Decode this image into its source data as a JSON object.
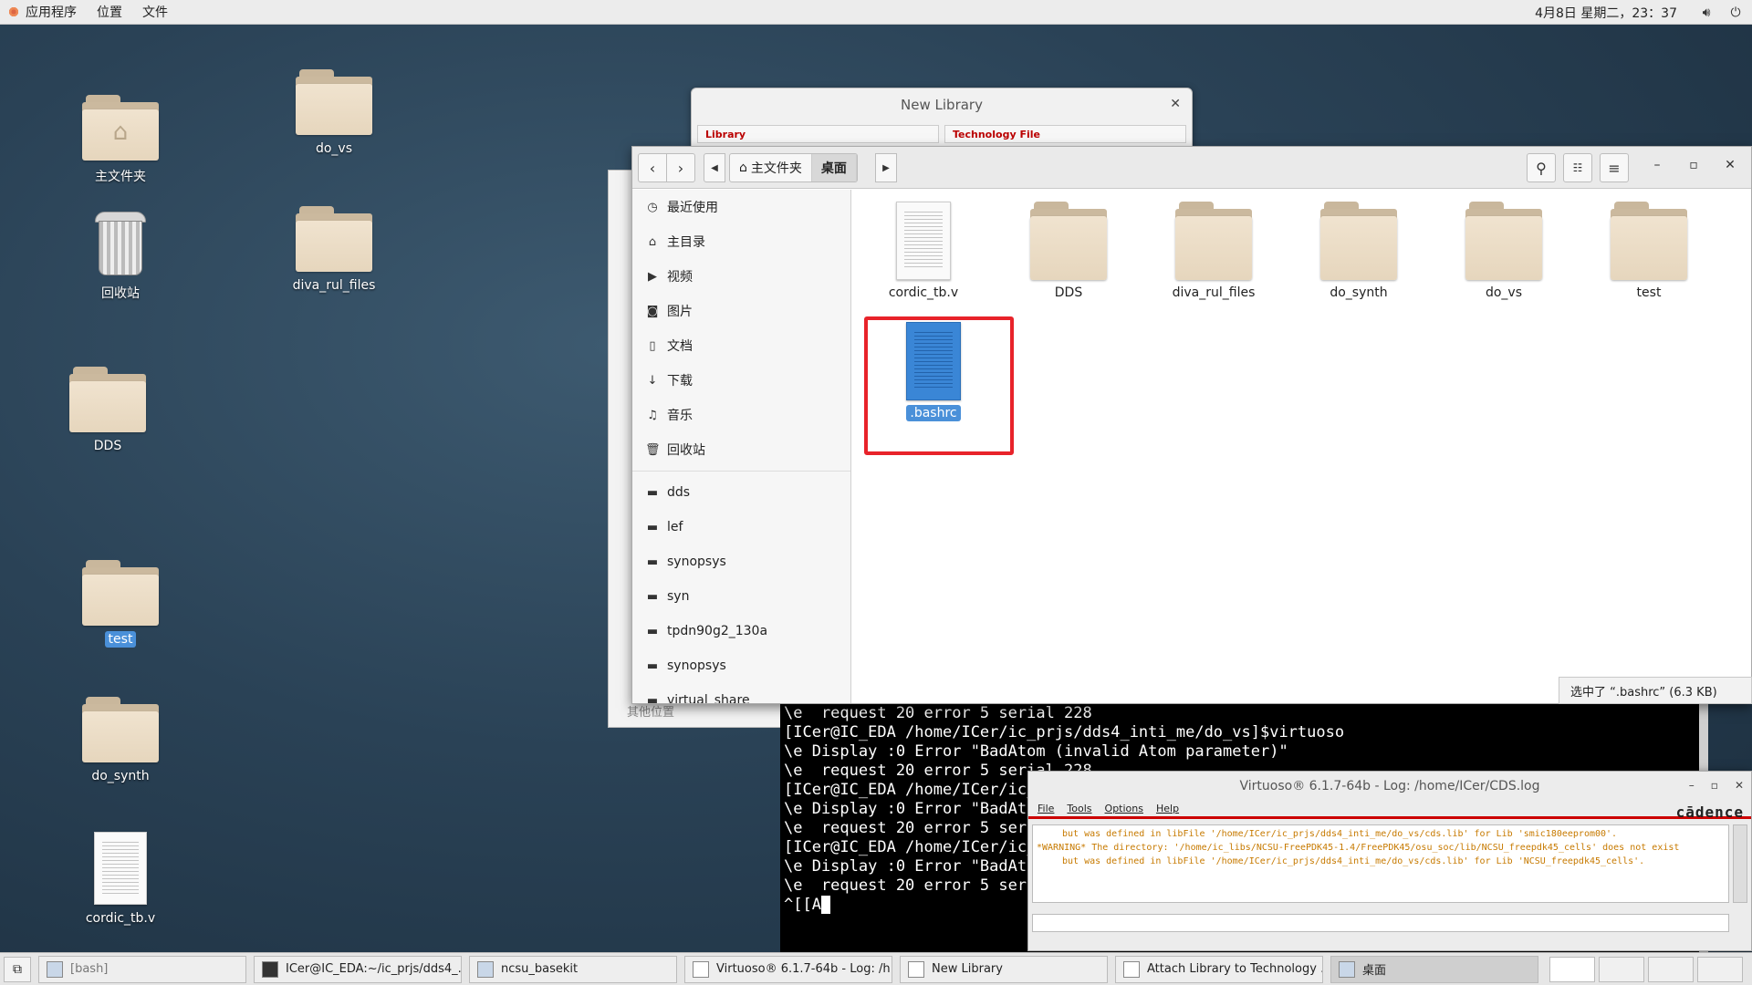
{
  "topbar": {
    "menu": [
      "应用程序",
      "位置",
      "文件"
    ],
    "clock": "4月8日 星期二，23：37",
    "icons": [
      "volume-icon",
      "power-icon"
    ]
  },
  "desktop": {
    "icons": [
      {
        "label": "主文件夹",
        "kind": "home-folder"
      },
      {
        "label": "回收站",
        "kind": "trash"
      },
      {
        "label": "DDS",
        "kind": "folder"
      },
      {
        "label": "test",
        "kind": "folder",
        "selected": true
      },
      {
        "label": "do_synth",
        "kind": "folder"
      },
      {
        "label": "cordic_tb.v",
        "kind": "document"
      },
      {
        "label": "do_vs",
        "kind": "folder"
      },
      {
        "label": "diva_rul_files",
        "kind": "folder"
      }
    ]
  },
  "new_library": {
    "title": "New Library",
    "tabs": [
      "Library",
      "Technology File"
    ]
  },
  "back_window": {
    "other_locations": "其他位置"
  },
  "file_manager": {
    "breadcrumb": [
      "主文件夹",
      "桌面"
    ],
    "sidebar": [
      {
        "label": "最近使用",
        "icon": "clock-icon"
      },
      {
        "label": "主目录",
        "icon": "home-icon"
      },
      {
        "label": "视频",
        "icon": "video-icon"
      },
      {
        "label": "图片",
        "icon": "camera-icon"
      },
      {
        "label": "文档",
        "icon": "document-icon"
      },
      {
        "label": "下载",
        "icon": "download-icon"
      },
      {
        "label": "音乐",
        "icon": "music-icon"
      },
      {
        "label": "回收站",
        "icon": "trash-icon"
      },
      {
        "label": "dds",
        "icon": "folder-icon"
      },
      {
        "label": "lef",
        "icon": "folder-icon"
      },
      {
        "label": "synopsys",
        "icon": "folder-icon"
      },
      {
        "label": "syn",
        "icon": "folder-icon"
      },
      {
        "label": "tpdn90g2_130a",
        "icon": "folder-icon"
      },
      {
        "label": "synopsys",
        "icon": "folder-icon"
      },
      {
        "label": "virtual_share",
        "icon": "folder-icon"
      }
    ],
    "files": [
      {
        "name": "cordic_tb.v",
        "kind": "document"
      },
      {
        "name": "DDS",
        "kind": "folder"
      },
      {
        "name": "diva_rul_files",
        "kind": "folder"
      },
      {
        "name": "do_synth",
        "kind": "folder"
      },
      {
        "name": "do_vs",
        "kind": "folder"
      },
      {
        "name": "test",
        "kind": "folder"
      },
      {
        "name": ".bashrc",
        "kind": "document",
        "selected": true
      }
    ],
    "status": "选中了 “.bashrc” (6.3 KB)"
  },
  "terminal": {
    "lines": [
      "\\e  request 20 error 5 serial 228",
      "[ICer@IC_EDA /home/ICer/ic_prjs/dds4_inti_me/do_vs]$virtuoso",
      "\\e Display :0 Error \"BadAtom (invalid Atom parameter)\"",
      "\\e  request 20 error 5 serial 228",
      "[ICer@IC_EDA /home/ICer/ic_",
      "\\e Display :0 Error \"BadAto",
      "\\e  request 20 error 5 seri",
      "[ICer@IC_EDA /home/ICer/ic_",
      "\\e Display :0 Error \"BadAto",
      "\\e  request 20 error 5 seri",
      "^[[A"
    ]
  },
  "virtuoso": {
    "title": "Virtuoso® 6.1.7-64b - Log: /home/ICer/CDS.log",
    "menu": [
      "File",
      "Tools",
      "Options",
      "Help"
    ],
    "brand": "cādence",
    "log": [
      "but was defined in libFile '/home/ICer/ic_prjs/dds4_inti_me/do_vs/cds.lib' for Lib 'smic180eeprom00'.",
      "*WARNING* The directory: '/home/ic_libs/NCSU-FreePDK45-1.4/FreePDK45/osu_soc/lib/NCSU_freepdk45_cells' does not exist",
      "but was defined in libFile '/home/ICer/ic_prjs/dds4_inti_me/do_vs/cds.lib' for Lib 'NCSU_freepdk45_cells'."
    ]
  },
  "taskbar": {
    "items": [
      {
        "label": "[bash]",
        "dim": true
      },
      {
        "label": "ICer@IC_EDA:~/ic_prjs/dds4_..."
      },
      {
        "label": "ncsu_basekit"
      },
      {
        "label": "Virtuoso® 6.1.7-64b - Log: /h..."
      },
      {
        "label": "New Library"
      },
      {
        "label": "Attach Library to Technology ..."
      },
      {
        "label": "桌面",
        "active": true
      }
    ]
  }
}
